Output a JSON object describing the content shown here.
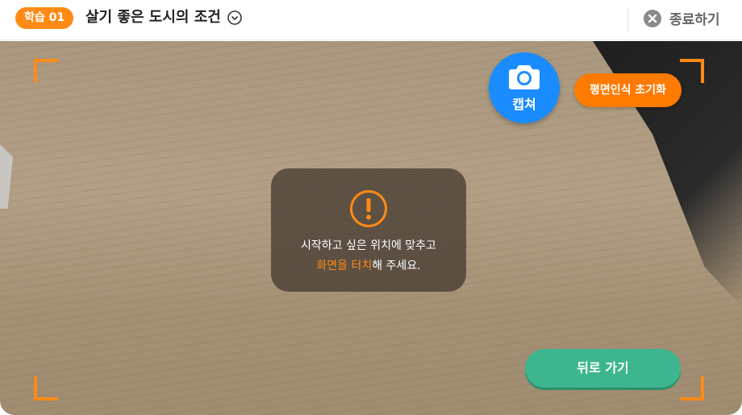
{
  "header": {
    "badge": "학습 01",
    "title": "살기 좋은 도시의 조건",
    "close_label": "종료하기"
  },
  "camera": {
    "capture_label": "캡쳐",
    "reset_label": "평면인식 초기화",
    "info": {
      "line1": "시작하고 싶은 위치에 맞추고",
      "highlight": "화면을 터치",
      "line2_rest": "해 주세요."
    },
    "back_label": "뒤로 가기"
  },
  "colors": {
    "accent_orange": "#ff8a16",
    "capture_blue": "#1a8cff",
    "back_green": "#3db68f"
  }
}
